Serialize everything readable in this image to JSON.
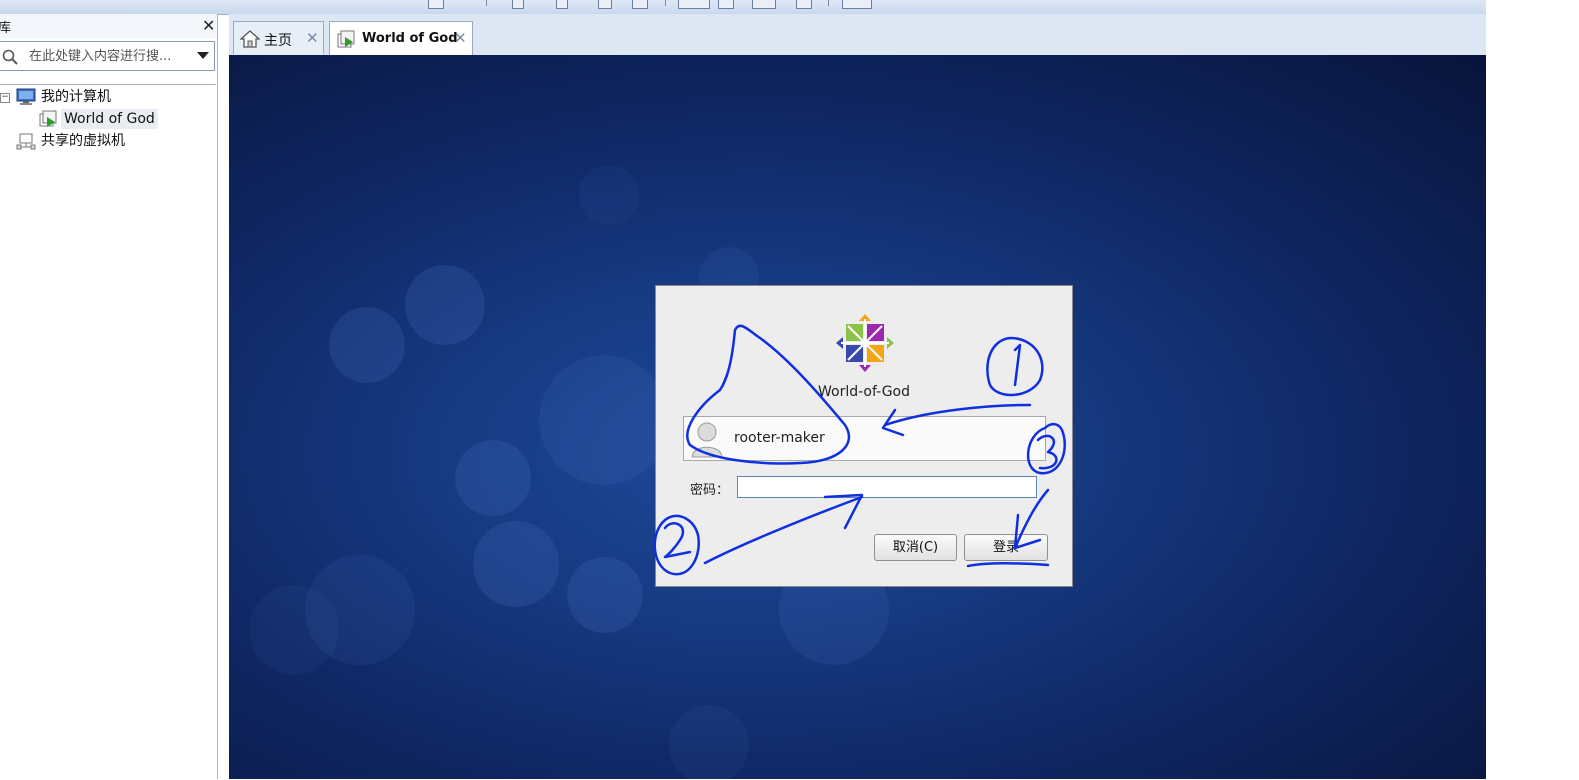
{
  "library": {
    "title": "库",
    "close_glyph": "✕",
    "search_placeholder": "在此处键入内容进行搜...",
    "tree": {
      "my_computer": "我的计算机",
      "vm_item": "World of God",
      "shared_vms": "共享的虚拟机",
      "collapse_glyph": "−"
    }
  },
  "tabs": [
    {
      "label": "主页",
      "icon": "home-icon",
      "close_glyph": "✕",
      "active": false
    },
    {
      "label": "World of God",
      "icon": "vm-running-icon",
      "close_glyph": "✕",
      "active": true
    }
  ],
  "login_dialog": {
    "hostname": "World-of-God",
    "username": "rooter-maker",
    "password_label": "密码：",
    "password_value": "",
    "cancel_button": "取消(C)",
    "login_button": "登录"
  },
  "colors": {
    "vm_background": "#173a82",
    "annotation_ink": "#1030e0",
    "dialog_background": "#ededed"
  },
  "annotations": {
    "note": "blue handwritten circled numbers 1, 2, 3 with arrows pointing to username, password field and login button"
  }
}
